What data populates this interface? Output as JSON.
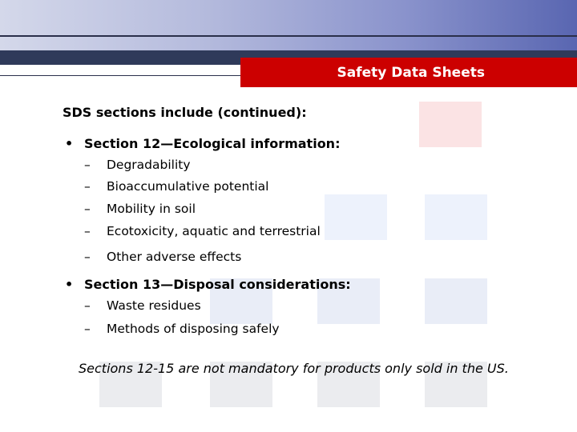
{
  "header": {
    "title": "Safety Data Sheets"
  },
  "content": {
    "intro": "SDS sections include (continued):",
    "bullet_glyph": "•",
    "dash_glyph": "–",
    "sections": [
      {
        "heading": "Section 12—Ecological information:",
        "items": [
          "Degradability",
          "Bioaccumulative potential",
          "Mobility in soil",
          "Ecotoxicity, aquatic and terrestrial",
          "Other adverse effects"
        ]
      },
      {
        "heading": "Section 13—Disposal considerations:",
        "items": [
          "Waste residues",
          "Methods of disposing safely"
        ]
      }
    ],
    "note": "Sections 12-15 are not mandatory for products only sold in the US."
  },
  "colors": {
    "title_bar": "#cc0000",
    "dark_band": "#2f3a5a",
    "gradient_end": "#5966b1"
  }
}
